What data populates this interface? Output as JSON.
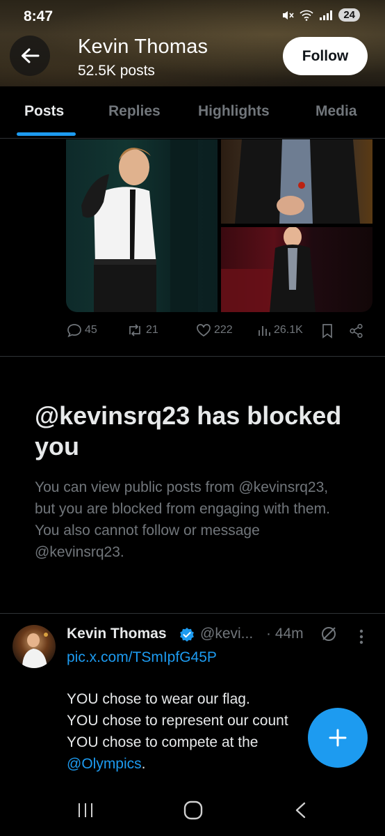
{
  "status_bar": {
    "time": "8:47",
    "battery": "24",
    "signal_label": "5"
  },
  "header": {
    "name": "Kevin Thomas",
    "posts_count": "52.5K posts",
    "follow_label": "Follow"
  },
  "tabs": [
    {
      "label": "Posts",
      "active": true
    },
    {
      "label": "Replies",
      "active": false
    },
    {
      "label": "Highlights",
      "active": false
    },
    {
      "label": "Media",
      "active": false
    }
  ],
  "post_actions": {
    "replies": "45",
    "reposts": "21",
    "likes": "222",
    "views": "26.1K"
  },
  "blocked": {
    "title": "@kevinsrq23 has blocked you",
    "body": "You can view public posts from @kevinsrq23, but you are blocked from engaging with them. You also cannot follow or message @kevinsrq23."
  },
  "tweet": {
    "name": "Kevin Thomas",
    "handle": "@kevi...",
    "time": "· 44m",
    "link": "pic.x.com/TSmIpfG45P",
    "lines": [
      "YOU chose to wear our flag.",
      "YOU chose to represent our count",
      "YOU chose to compete at the"
    ],
    "mention": "@Olympics",
    "mention_suffix": "."
  },
  "colors": {
    "accent": "#1d9bf0",
    "background": "#000000",
    "muted_text": "#71767b",
    "primary_text": "#e7e9ea"
  },
  "icons": {
    "back": "arrow-left-icon",
    "reply": "reply-icon",
    "repost": "repost-icon",
    "like": "heart-icon",
    "views": "views-icon",
    "bookmark": "bookmark-icon",
    "share": "share-icon",
    "compose": "plus-icon",
    "grok": "slash-circle-icon",
    "more": "more-vertical-icon"
  }
}
